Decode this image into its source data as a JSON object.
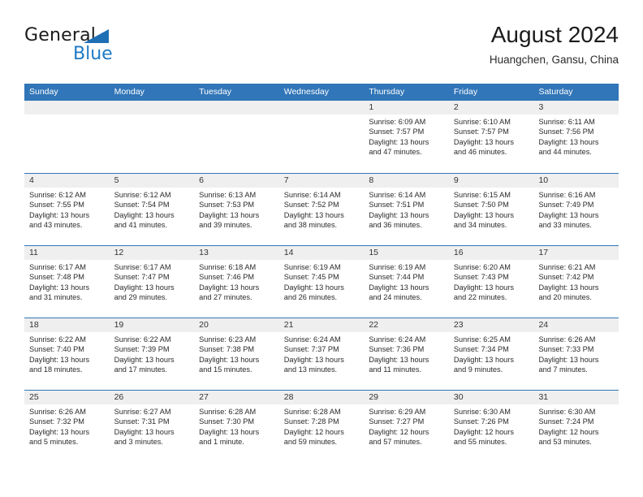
{
  "brand": {
    "name_part1": "General",
    "name_part2": "Blue",
    "triangle_color": "#1f6fb5",
    "blue_color": "#1f7ac4"
  },
  "header": {
    "title": "August 2024",
    "subtitle": "Huangchen, Gansu, China"
  },
  "theme": {
    "header_blue": "#3176b8",
    "day_band_gray": "#efefef",
    "text": "#2a2a2a"
  },
  "weekdays": [
    "Sunday",
    "Monday",
    "Tuesday",
    "Wednesday",
    "Thursday",
    "Friday",
    "Saturday"
  ],
  "weeks": [
    [
      {
        "day": "",
        "lines": []
      },
      {
        "day": "",
        "lines": []
      },
      {
        "day": "",
        "lines": []
      },
      {
        "day": "",
        "lines": []
      },
      {
        "day": "1",
        "lines": [
          "Sunrise: 6:09 AM",
          "Sunset: 7:57 PM",
          "Daylight: 13 hours",
          "and 47 minutes."
        ]
      },
      {
        "day": "2",
        "lines": [
          "Sunrise: 6:10 AM",
          "Sunset: 7:57 PM",
          "Daylight: 13 hours",
          "and 46 minutes."
        ]
      },
      {
        "day": "3",
        "lines": [
          "Sunrise: 6:11 AM",
          "Sunset: 7:56 PM",
          "Daylight: 13 hours",
          "and 44 minutes."
        ]
      }
    ],
    [
      {
        "day": "4",
        "lines": [
          "Sunrise: 6:12 AM",
          "Sunset: 7:55 PM",
          "Daylight: 13 hours",
          "and 43 minutes."
        ]
      },
      {
        "day": "5",
        "lines": [
          "Sunrise: 6:12 AM",
          "Sunset: 7:54 PM",
          "Daylight: 13 hours",
          "and 41 minutes."
        ]
      },
      {
        "day": "6",
        "lines": [
          "Sunrise: 6:13 AM",
          "Sunset: 7:53 PM",
          "Daylight: 13 hours",
          "and 39 minutes."
        ]
      },
      {
        "day": "7",
        "lines": [
          "Sunrise: 6:14 AM",
          "Sunset: 7:52 PM",
          "Daylight: 13 hours",
          "and 38 minutes."
        ]
      },
      {
        "day": "8",
        "lines": [
          "Sunrise: 6:14 AM",
          "Sunset: 7:51 PM",
          "Daylight: 13 hours",
          "and 36 minutes."
        ]
      },
      {
        "day": "9",
        "lines": [
          "Sunrise: 6:15 AM",
          "Sunset: 7:50 PM",
          "Daylight: 13 hours",
          "and 34 minutes."
        ]
      },
      {
        "day": "10",
        "lines": [
          "Sunrise: 6:16 AM",
          "Sunset: 7:49 PM",
          "Daylight: 13 hours",
          "and 33 minutes."
        ]
      }
    ],
    [
      {
        "day": "11",
        "lines": [
          "Sunrise: 6:17 AM",
          "Sunset: 7:48 PM",
          "Daylight: 13 hours",
          "and 31 minutes."
        ]
      },
      {
        "day": "12",
        "lines": [
          "Sunrise: 6:17 AM",
          "Sunset: 7:47 PM",
          "Daylight: 13 hours",
          "and 29 minutes."
        ]
      },
      {
        "day": "13",
        "lines": [
          "Sunrise: 6:18 AM",
          "Sunset: 7:46 PM",
          "Daylight: 13 hours",
          "and 27 minutes."
        ]
      },
      {
        "day": "14",
        "lines": [
          "Sunrise: 6:19 AM",
          "Sunset: 7:45 PM",
          "Daylight: 13 hours",
          "and 26 minutes."
        ]
      },
      {
        "day": "15",
        "lines": [
          "Sunrise: 6:19 AM",
          "Sunset: 7:44 PM",
          "Daylight: 13 hours",
          "and 24 minutes."
        ]
      },
      {
        "day": "16",
        "lines": [
          "Sunrise: 6:20 AM",
          "Sunset: 7:43 PM",
          "Daylight: 13 hours",
          "and 22 minutes."
        ]
      },
      {
        "day": "17",
        "lines": [
          "Sunrise: 6:21 AM",
          "Sunset: 7:42 PM",
          "Daylight: 13 hours",
          "and 20 minutes."
        ]
      }
    ],
    [
      {
        "day": "18",
        "lines": [
          "Sunrise: 6:22 AM",
          "Sunset: 7:40 PM",
          "Daylight: 13 hours",
          "and 18 minutes."
        ]
      },
      {
        "day": "19",
        "lines": [
          "Sunrise: 6:22 AM",
          "Sunset: 7:39 PM",
          "Daylight: 13 hours",
          "and 17 minutes."
        ]
      },
      {
        "day": "20",
        "lines": [
          "Sunrise: 6:23 AM",
          "Sunset: 7:38 PM",
          "Daylight: 13 hours",
          "and 15 minutes."
        ]
      },
      {
        "day": "21",
        "lines": [
          "Sunrise: 6:24 AM",
          "Sunset: 7:37 PM",
          "Daylight: 13 hours",
          "and 13 minutes."
        ]
      },
      {
        "day": "22",
        "lines": [
          "Sunrise: 6:24 AM",
          "Sunset: 7:36 PM",
          "Daylight: 13 hours",
          "and 11 minutes."
        ]
      },
      {
        "day": "23",
        "lines": [
          "Sunrise: 6:25 AM",
          "Sunset: 7:34 PM",
          "Daylight: 13 hours",
          "and 9 minutes."
        ]
      },
      {
        "day": "24",
        "lines": [
          "Sunrise: 6:26 AM",
          "Sunset: 7:33 PM",
          "Daylight: 13 hours",
          "and 7 minutes."
        ]
      }
    ],
    [
      {
        "day": "25",
        "lines": [
          "Sunrise: 6:26 AM",
          "Sunset: 7:32 PM",
          "Daylight: 13 hours",
          "and 5 minutes."
        ]
      },
      {
        "day": "26",
        "lines": [
          "Sunrise: 6:27 AM",
          "Sunset: 7:31 PM",
          "Daylight: 13 hours",
          "and 3 minutes."
        ]
      },
      {
        "day": "27",
        "lines": [
          "Sunrise: 6:28 AM",
          "Sunset: 7:30 PM",
          "Daylight: 13 hours",
          "and 1 minute."
        ]
      },
      {
        "day": "28",
        "lines": [
          "Sunrise: 6:28 AM",
          "Sunset: 7:28 PM",
          "Daylight: 12 hours",
          "and 59 minutes."
        ]
      },
      {
        "day": "29",
        "lines": [
          "Sunrise: 6:29 AM",
          "Sunset: 7:27 PM",
          "Daylight: 12 hours",
          "and 57 minutes."
        ]
      },
      {
        "day": "30",
        "lines": [
          "Sunrise: 6:30 AM",
          "Sunset: 7:26 PM",
          "Daylight: 12 hours",
          "and 55 minutes."
        ]
      },
      {
        "day": "31",
        "lines": [
          "Sunrise: 6:30 AM",
          "Sunset: 7:24 PM",
          "Daylight: 12 hours",
          "and 53 minutes."
        ]
      }
    ]
  ]
}
